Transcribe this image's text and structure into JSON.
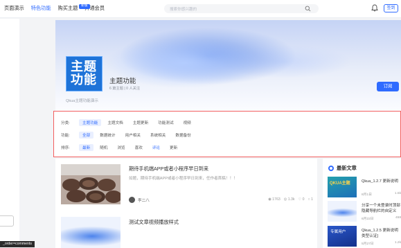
{
  "nav": {
    "items": [
      "页面演示",
      "特色功能",
      "购买主题",
      "开通会员"
    ],
    "new_badge": "新版"
  },
  "search": {
    "placeholder": "搜索你感兴趣的"
  },
  "header_right": {
    "signin": "签到"
  },
  "hero": {
    "logo_line1": "主题",
    "logo_line2": "功能",
    "title": "主题功能",
    "meta": "6 篇主题  |  0 人关注",
    "desc": "Qkua主题功能演示",
    "subscribe": "订阅"
  },
  "filters": {
    "category_label": "分类:",
    "category_options": [
      "主题功能",
      "主题文档",
      "主题更新",
      "功能测试",
      "视频"
    ],
    "feature_label": "功能:",
    "feature_options": [
      "全部",
      "数据统计",
      "用户相关",
      "系统相关",
      "数据备份"
    ],
    "sort_label": "排序:",
    "sort_options": [
      "最新",
      "随机",
      "浏览",
      "喜欢",
      "评论",
      "更新"
    ]
  },
  "articles": [
    {
      "title": "期待手机端APP或者小程序早日到来",
      "excerpt": "如题，期待手机端APP或者小程序早日到来，任作者首稿！！！",
      "author": "李二八",
      "views": "1763",
      "comments": "1.3k",
      "likes": "0",
      "replies": "1"
    },
    {
      "title": "测试文章视频播放样式"
    }
  ],
  "sidebar": {
    "title": "最新文章",
    "items": [
      {
        "thumb_text": "QKUA主题",
        "title": "Qkua_1.2.7 更新说明",
        "date": "8月1日",
        "count": "1.5k"
      },
      {
        "title": "分享一个未登录时顶部",
        "subtitle": "隐藏导航栏的自定义",
        "date": "6月22日",
        "count": "458"
      },
      {
        "thumb_text": "专属用户",
        "title": "Qkua_1.2.5 更新说明",
        "subtitle": "类型认证]",
        "date": "5月27日",
        "count": "1.2k"
      }
    ]
  },
  "tooltip": "_order=comments",
  "colors": {
    "accent": "#2f6bff",
    "highlight_border": "#f25e5e",
    "logo_bg": "#1e73d8"
  }
}
